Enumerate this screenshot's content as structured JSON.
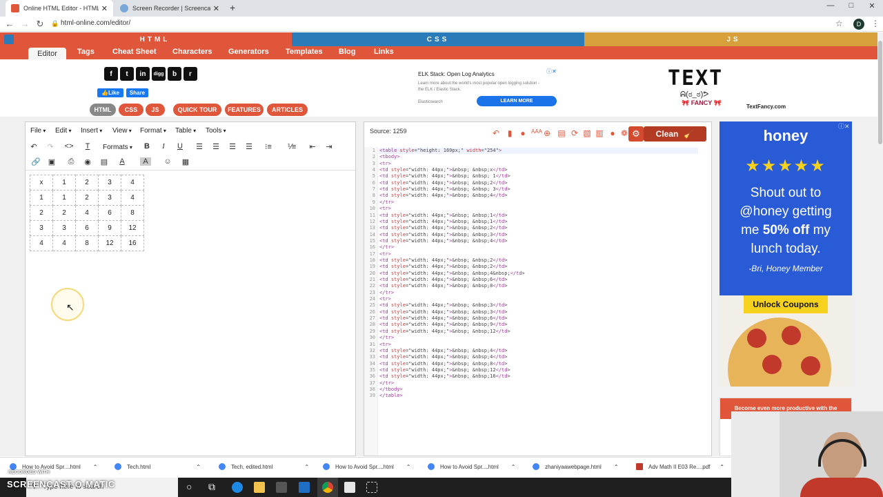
{
  "browser": {
    "tabs": [
      {
        "title": "Online HTML Editor - HTML-Onli",
        "active": true
      },
      {
        "title": "Screen Recorder | Screencast-O-",
        "active": false
      }
    ],
    "new_tab": "+",
    "url": "html-online.com/editor/",
    "profile": "D",
    "window_controls": [
      "—",
      "□",
      "✕"
    ]
  },
  "site": {
    "sections": [
      {
        "label": "HTML",
        "color": "#e0563b"
      },
      {
        "label": "CSS",
        "color": "#2a7bb8"
      },
      {
        "label": "JS",
        "color": "#d8a03a"
      }
    ],
    "nav": [
      "Editor",
      "Tags",
      "Cheat Sheet",
      "Characters",
      "Generators",
      "Templates",
      "Blog",
      "Links"
    ],
    "social": [
      "f",
      "t",
      "in",
      "digg",
      "b",
      "r"
    ],
    "fb_like": "Like",
    "fb_share": "Share",
    "pills": [
      "HTML",
      "CSS",
      "JS",
      "QUICK TOUR",
      "FEATURES",
      "ARTICLES"
    ],
    "ad": {
      "title": "ELK Stack: Open Log Analytics",
      "body": "Learn more about the world's most popular open logging solution - the ELK / Elastic Stack.",
      "source": "Elasticsearch",
      "cta": "LEARN MORE"
    },
    "textfancy": {
      "logo": "TEXT",
      "sub": "TextFancy.com"
    }
  },
  "editor": {
    "menus": [
      "File",
      "Edit",
      "Insert",
      "View",
      "Format",
      "Table",
      "Tools"
    ],
    "formats_label": "Formats",
    "table": [
      [
        "x",
        "1",
        "2",
        "3",
        "4"
      ],
      [
        "1",
        "1",
        "2",
        "3",
        "4"
      ],
      [
        "2",
        "2",
        "4",
        "6",
        "8"
      ],
      [
        "3",
        "3",
        "6",
        "9",
        "12"
      ],
      [
        "4",
        "4",
        "8",
        "12",
        "16"
      ]
    ]
  },
  "source": {
    "label": "Source: 1259",
    "clean_label": "Clean",
    "lines": [
      "<table style=\"height: 169px;\" width=\"254\">",
      "<tbody>",
      "<tr>",
      "<td style=\"width: 44px;\">&nbsp; &nbsp;x</td>",
      "<td style=\"width: 44px;\">&nbsp; &nbsp; 1</td>",
      "<td style=\"width: 44px;\">&nbsp; &nbsp;2</td>",
      "<td style=\"width: 44px;\">&nbsp; &nbsp; 3</td>",
      "<td style=\"width: 44px;\">&nbsp; &nbsp;4</td>",
      "</tr>",
      "<tr>",
      "<td style=\"width: 44px;\">&nbsp; &nbsp;1</td>",
      "<td style=\"width: 44px;\">&nbsp; &nbsp;1</td>",
      "<td style=\"width: 44px;\">&nbsp; &nbsp;2</td>",
      "<td style=\"width: 44px;\">&nbsp; &nbsp;3</td>",
      "<td style=\"width: 44px;\">&nbsp; &nbsp;4</td>",
      "</tr>",
      "<tr>",
      "<td style=\"width: 44px;\">&nbsp; &nbsp;2</td>",
      "<td style=\"width: 44px;\">&nbsp; &nbsp;2</td>",
      "<td style=\"width: 44px;\">&nbsp; &nbsp;4&nbsp;</td>",
      "<td style=\"width: 44px;\">&nbsp; &nbsp;6</td>",
      "<td style=\"width: 44px;\">&nbsp; &nbsp;8</td>",
      "</tr>",
      "<tr>",
      "<td style=\"width: 44px;\">&nbsp; &nbsp;3</td>",
      "<td style=\"width: 44px;\">&nbsp; &nbsp;3</td>",
      "<td style=\"width: 44px;\">&nbsp; &nbsp;6</td>",
      "<td style=\"width: 44px;\">&nbsp; &nbsp;9</td>",
      "<td style=\"width: 44px;\">&nbsp; &nbsp;12</td>",
      "</tr>",
      "<tr>",
      "<td style=\"width: 44px;\">&nbsp; &nbsp;4</td>",
      "<td style=\"width: 44px;\">&nbsp; &nbsp;4</td>",
      "<td style=\"width: 44px;\">&nbsp; &nbsp;8</td>",
      "<td style=\"width: 44px;\">&nbsp; &nbsp;12</td>",
      "<td style=\"width: 44px;\">&nbsp; &nbsp;16</td>",
      "</tr>",
      "</tbody>",
      "</table>"
    ]
  },
  "honey_ad": {
    "brand": "honey",
    "stars": "★★★★★",
    "line1": "Shout out to",
    "line2": "@honey getting",
    "line3a": "me ",
    "line3b": "50% off",
    "line3c": " my",
    "line4": "lunch today.",
    "attribution": "-Bri, Honey Member",
    "cta": "Unlock Coupons",
    "next_ad": "Become even more productive with the"
  },
  "downloads": [
    "How to Avoid Spr....html",
    "Tech.html",
    "Tech, edited.html",
    "How to Avoid Spr....html",
    "How to Avoid Spr....html",
    "zhaniyaawebpage.html",
    "Adv Math II E03 Re....pdf"
  ],
  "taskbar": {
    "search_placeholder": "Type here to search",
    "watermark_top": "RECORDED WITH",
    "watermark": "SCREENCAST-O-MATIC"
  },
  "colors": {
    "accent": "#e0563b",
    "css": "#2a7bb8",
    "js": "#d8a03a",
    "honey": "#2a5bd7",
    "coupon": "#f6d21e"
  }
}
